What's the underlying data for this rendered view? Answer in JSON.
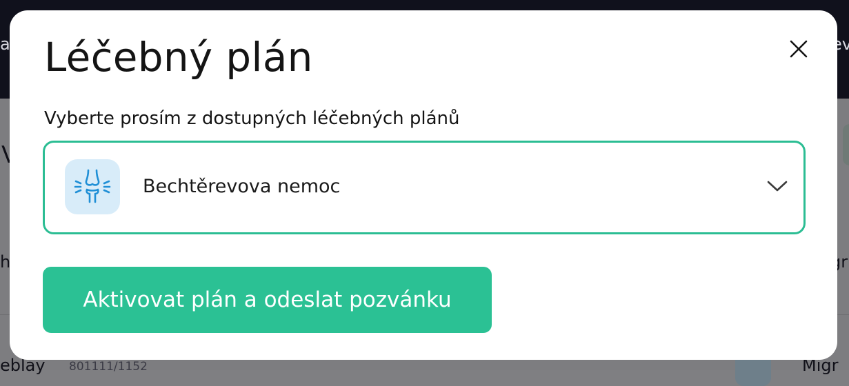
{
  "modal": {
    "title": "Léčebný plán",
    "close_icon": "close-icon",
    "label": "Vyberte prosím z dostupných léčebných plánů",
    "select": {
      "value": "Bechtěrevova nemoc",
      "icon": "joint-icon",
      "chevron_icon": "chevron-down-icon"
    },
    "primary_button": "Aktivovat plán a odeslat pozvánku"
  },
  "background": {
    "left_fragment": "a",
    "right_fragment": "ev",
    "left_list_fragment": "h",
    "right_list_fragment": "gr",
    "bottom_name_fragment": "eblay",
    "bottom_id_fragment": "801111/1152",
    "bottom_right_fragment": "Migr",
    "left_side_fragment": "V"
  },
  "colors": {
    "accent": "#2bc194",
    "accent_border": "#2bbd93",
    "icon_background": "#d8ecf9",
    "icon_stroke": "#1f8fd6",
    "overlay_top": "#10111c"
  }
}
